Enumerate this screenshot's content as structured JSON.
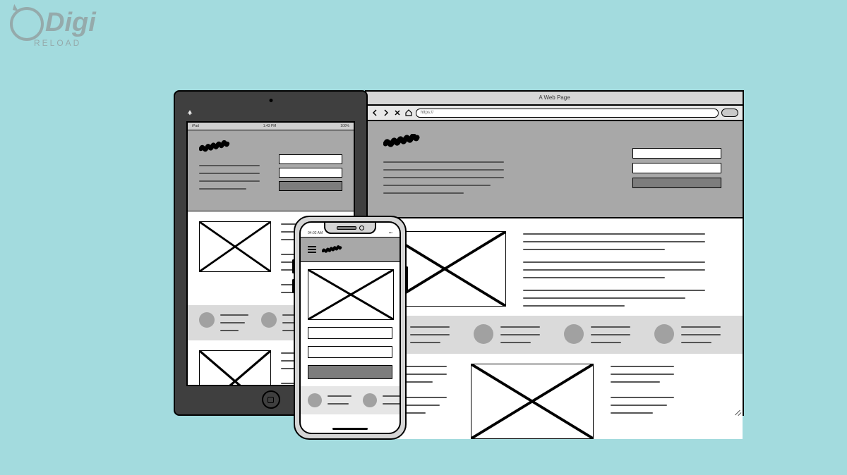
{
  "brand": {
    "name": "Digi",
    "sub": "RELOAD"
  },
  "browser": {
    "title": "A Web Page",
    "url": "https://",
    "nav_back": "back",
    "nav_fwd": "forward",
    "nav_close": "close",
    "nav_home": "home"
  },
  "tablet": {
    "carrier": "iPad",
    "time": "1:43 PM",
    "battery": "100%"
  },
  "phone": {
    "time": "04:02 AM",
    "signal": "•••"
  }
}
